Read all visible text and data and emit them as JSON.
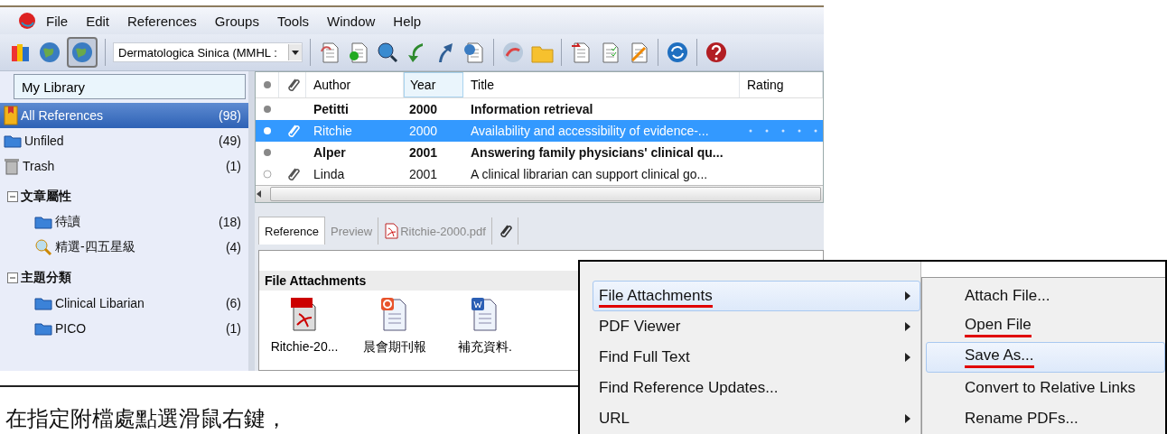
{
  "menu_bar": {
    "items": [
      "File",
      "Edit",
      "References",
      "Groups",
      "Tools",
      "Window",
      "Help"
    ]
  },
  "toolbar": {
    "style_select": "Dermatologica Sinica (MMHL :"
  },
  "groups_panel": {
    "header": "My Library",
    "items": [
      {
        "kind": "library",
        "label": "All References",
        "count": "(98)",
        "selected": true
      },
      {
        "kind": "unfiled",
        "label": "Unfiled",
        "count": "(49)",
        "selected": false
      },
      {
        "kind": "trash",
        "label": "Trash",
        "count": "(1)",
        "selected": false
      },
      {
        "kind": "heading",
        "label": "文章屬性",
        "expanded": true,
        "selected": false,
        "children": [
          {
            "kind": "folder",
            "label": "待讀",
            "count": "(18)",
            "selected": false
          },
          {
            "kind": "smart",
            "label": "精選-四五星級",
            "count": "(4)",
            "selected": false
          }
        ]
      },
      {
        "kind": "heading",
        "label": "主題分類",
        "expanded": true,
        "selected": false,
        "children": [
          {
            "kind": "folder",
            "label": "Clinical Libarian",
            "count": "(6)",
            "selected": false
          },
          {
            "kind": "folder",
            "label": "PICO",
            "count": "(1)",
            "selected": false
          }
        ]
      }
    ]
  },
  "reference_table": {
    "columns": [
      "Author",
      "Year",
      "Title",
      "Rating"
    ],
    "rows": [
      {
        "author": "Petitti",
        "year": "2000",
        "title": "Information retrieval",
        "read": false,
        "attachment": false,
        "selected": false
      },
      {
        "author": "Ritchie",
        "year": "2000",
        "title": "Availability and accessibility of evidence-...",
        "read": true,
        "attachment": true,
        "selected": true
      },
      {
        "author": "Alper",
        "year": "2001",
        "title": "Answering family physicians' clinical qu...",
        "read": false,
        "attachment": false,
        "selected": false
      },
      {
        "author": "Linda",
        "year": "2001",
        "title": "A clinical librarian can support clinical go...",
        "read": true,
        "attachment": true,
        "selected": false
      }
    ]
  },
  "detail_tabs": [
    {
      "label": "Reference",
      "kind": "text",
      "selected": true
    },
    {
      "label": "Preview",
      "kind": "text",
      "selected": false
    },
    {
      "label": "Ritchie-2000.pdf",
      "kind": "pdf",
      "selected": false
    }
  ],
  "attachments_pane": {
    "title": "File Attachments",
    "files": [
      {
        "kind": "pdf",
        "name": "Ritchie-20..."
      },
      {
        "kind": "pptx",
        "name": "晨會期刊報"
      },
      {
        "kind": "docx",
        "name": "補充資料."
      }
    ]
  },
  "context_menu": {
    "items": [
      {
        "label": "File Attachments",
        "submenu": true,
        "selected": true,
        "underlined": true
      },
      {
        "label": "PDF Viewer",
        "submenu": true,
        "selected": false,
        "underlined": false
      },
      {
        "label": "Find Full Text",
        "submenu": true,
        "selected": false,
        "underlined": false
      },
      {
        "label": "Find Reference Updates...",
        "submenu": false,
        "selected": false,
        "underlined": false
      },
      {
        "label": "URL",
        "submenu": true,
        "selected": false,
        "underlined": false
      }
    ],
    "submenu": [
      {
        "label": "Attach File...",
        "selected": false,
        "underlined": false
      },
      {
        "label": "Open File",
        "selected": false,
        "underlined": true
      },
      {
        "label": "Save As...",
        "selected": true,
        "underlined": true
      },
      {
        "label": "Convert to Relative Links",
        "selected": false,
        "underlined": false
      },
      {
        "label": "Rename PDFs...",
        "selected": false,
        "underlined": false
      }
    ]
  },
  "caption": "在指定附檔處點選滑鼠右鍵，"
}
